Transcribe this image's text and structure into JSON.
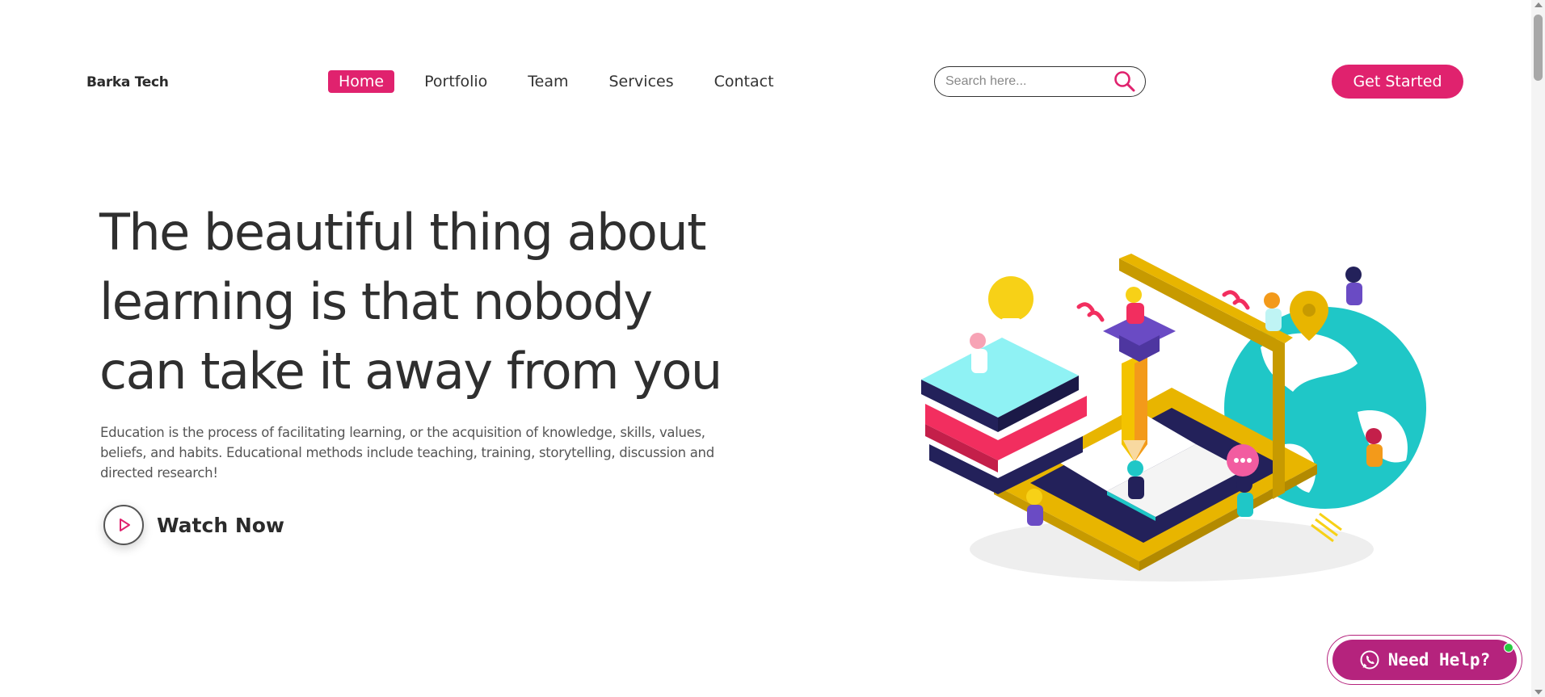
{
  "header": {
    "brand": "Barka Tech",
    "nav": [
      {
        "label": "Home",
        "active": true
      },
      {
        "label": "Portfolio",
        "active": false
      },
      {
        "label": "Team",
        "active": false
      },
      {
        "label": "Services",
        "active": false
      },
      {
        "label": "Contact",
        "active": false
      }
    ],
    "search": {
      "placeholder": "Search here...",
      "value": "",
      "icon": "search-icon"
    },
    "cta_label": "Get Started"
  },
  "hero": {
    "headline_lines": [
      "The beautiful thing about",
      "learning is that nobody",
      "can take it away from you"
    ],
    "description": "Education is the process of facilitating learning, or the acquisition of knowledge, skills, values, beliefs, and habits. Educational methods include teaching, training, storytelling, discussion and directed research!",
    "watch_label": "Watch Now",
    "watch_icon": "play-icon"
  },
  "help_widget": {
    "label": "Need Help?",
    "icon": "whatsapp-icon",
    "status": "online"
  },
  "colors": {
    "accent": "#e0226e",
    "help": "#b5237d",
    "online": "#27c93f",
    "text": "#2f2f2f"
  }
}
